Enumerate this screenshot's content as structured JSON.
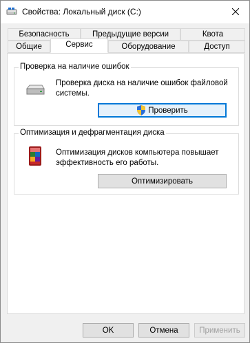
{
  "window": {
    "title": "Свойства: Локальный диск (C:)"
  },
  "tabs": {
    "row1": [
      {
        "label": "Безопасность"
      },
      {
        "label": "Предыдущие версии"
      },
      {
        "label": "Квота"
      }
    ],
    "row2": [
      {
        "label": "Общие"
      },
      {
        "label": "Сервис",
        "active": true
      },
      {
        "label": "Оборудование"
      },
      {
        "label": "Доступ"
      }
    ]
  },
  "error_check": {
    "title": "Проверка на наличие ошибок",
    "description": "Проверка диска на наличие ошибок файловой системы.",
    "button_label": "Проверить",
    "icon": "drive-icon"
  },
  "optimize": {
    "title": "Оптимизация и дефрагментация диска",
    "description": "Оптимизация дисков компьютера повышает эффективность его работы.",
    "button_label": "Оптимизировать",
    "icon": "defrag-icon"
  },
  "footer": {
    "ok_label": "OK",
    "cancel_label": "Отмена",
    "apply_label": "Применить"
  },
  "colors": {
    "accent": "#0078d7"
  }
}
